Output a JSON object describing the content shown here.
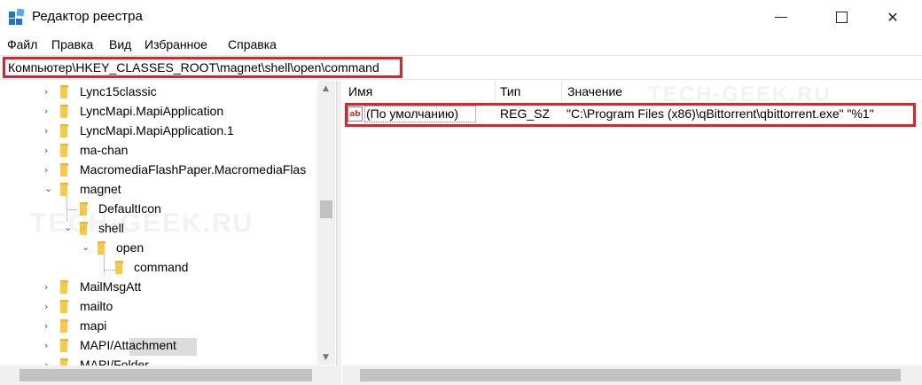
{
  "window": {
    "title": "Редактор реестра",
    "icon": "regedit-icon"
  },
  "menu": [
    {
      "label": "Файл"
    },
    {
      "label": "Правка"
    },
    {
      "label": "Вид"
    },
    {
      "label": "Избранное"
    },
    {
      "label": "Справка"
    }
  ],
  "address": {
    "path": "Компьютер\\HKEY_CLASSES_ROOT\\magnet\\shell\\open\\command"
  },
  "tree": [
    {
      "label": "Lync15classic",
      "expanded": false
    },
    {
      "label": "LyncMapi.MapiApplication",
      "expanded": false
    },
    {
      "label": "LyncMapi.MapiApplication.1",
      "expanded": false
    },
    {
      "label": "ma-chan",
      "expanded": false
    },
    {
      "label": "MacromediaFlashPaper.MacromediaFlas",
      "expanded": false
    },
    {
      "label": "magnet",
      "expanded": true
    },
    {
      "label": "DefaultIcon",
      "expanded": false
    },
    {
      "label": "shell",
      "expanded": true
    },
    {
      "label": "open",
      "expanded": true
    },
    {
      "label": "command",
      "selected": true
    },
    {
      "label": "MailMsgAtt",
      "expanded": false
    },
    {
      "label": "mailto",
      "expanded": false
    },
    {
      "label": "mapi",
      "expanded": false
    },
    {
      "label": "MAPI/Attachment",
      "expanded": false
    },
    {
      "label": "MAPI/Folder",
      "expanded": false
    }
  ],
  "values": {
    "headers": {
      "name": "Имя",
      "type": "Тип",
      "data": "Значение"
    },
    "rows": [
      {
        "icon": "ab",
        "name": "(По умолчанию)",
        "type": "REG_SZ",
        "data": "\"C:\\Program Files (x86)\\qBittorrent\\qbittorrent.exe\" \"%1\""
      }
    ]
  },
  "watermark": "TECH-GEEK.RU",
  "highlight_color": "#d9232d"
}
